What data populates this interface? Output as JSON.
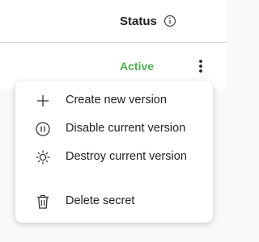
{
  "table": {
    "status_header": "Status",
    "status_value": "Active"
  },
  "menu": {
    "items": [
      {
        "label": "Create new version",
        "icon": "plus-icon"
      },
      {
        "label": "Disable current version",
        "icon": "pause-circle-icon"
      },
      {
        "label": "Destroy current version",
        "icon": "destroy-burst-icon"
      },
      {
        "label": "Delete secret",
        "icon": "trash-icon"
      }
    ]
  },
  "colors": {
    "active_status": "#4caf50",
    "menu_background": "#ffffff",
    "page_background": "#f8f9fa"
  }
}
